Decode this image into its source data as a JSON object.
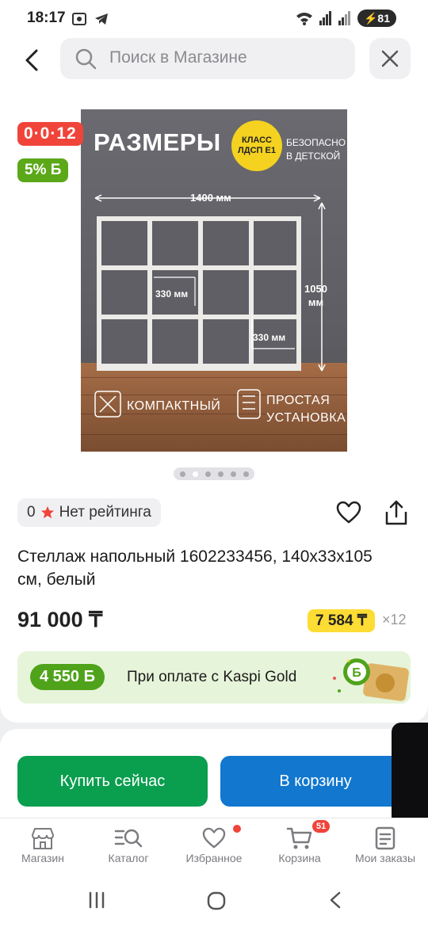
{
  "status_bar": {
    "time": "18:17",
    "battery": "81"
  },
  "search": {
    "placeholder": "Поиск в Магазине"
  },
  "promos": {
    "installment": "0·0·12",
    "bonus": "5% Б"
  },
  "image": {
    "title": "РАЗМЕРЫ",
    "badge_line1": "КЛАСС",
    "badge_line2": "ЛДСП Е1",
    "safe_line1": "БЕЗОПАСНО",
    "safe_line2": "В ДЕТСКОЙ",
    "width_label": "1400 мм",
    "height_label_1": "1050",
    "height_label_2": "мм",
    "cell_label_1": "330 мм",
    "cell_label_2": "330 мм",
    "feature1": "КОМПАКТНЫЙ",
    "feature2_line1": "ПРОСТАЯ",
    "feature2_line2": "УСТАНОВКА",
    "slide_count": 6,
    "active_slide": 2
  },
  "rating": {
    "value": "0",
    "text": "Нет рейтинга"
  },
  "product": {
    "title": "Стеллаж напольный 1602233456, 140x33x105 см, белый",
    "price": "91 000 ₸",
    "installment_price": "7 584 ₸",
    "installment_mult": "×12"
  },
  "kaspi_gold": {
    "bonus": "4 550 Б",
    "text": "При оплате с Kaspi Gold"
  },
  "actions": {
    "buy": "Купить сейчас",
    "cart": "В корзину"
  },
  "tabs": [
    {
      "label": "Магазин",
      "icon": "shop-icon"
    },
    {
      "label": "Каталог",
      "icon": "catalog-icon"
    },
    {
      "label": "Избранное",
      "icon": "heart-icon"
    },
    {
      "label": "Корзина",
      "icon": "cart-icon",
      "badge": "51"
    },
    {
      "label": "Мои заказы",
      "icon": "orders-icon"
    }
  ],
  "colors": {
    "buy": "#0a9e4f",
    "cart": "#1177cf",
    "promo_red": "#f0443a",
    "promo_green": "#5ba819",
    "installment_yellow": "#fddc34"
  }
}
